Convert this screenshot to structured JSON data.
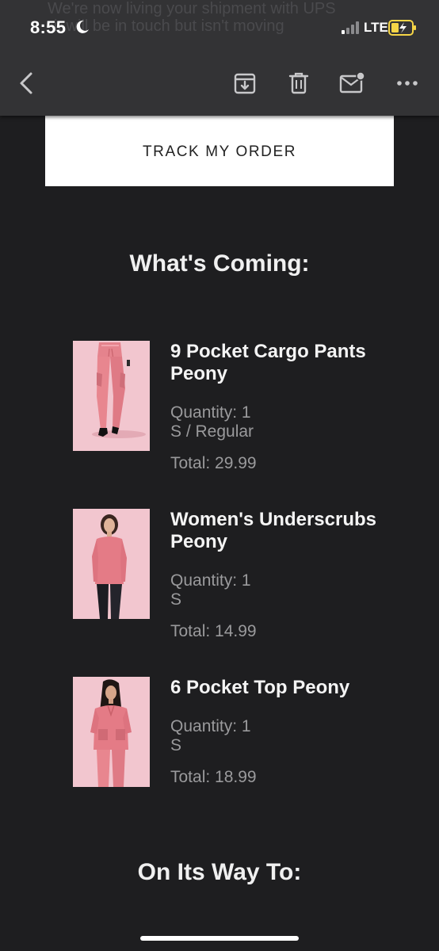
{
  "status_bar": {
    "time": "8:55",
    "network": "LTE"
  },
  "background_preview": {
    "line1": "We're now living your shipment with UPS",
    "line2": "it will be in touch but isn't moving"
  },
  "toolbar": {
    "icons": [
      "back-icon",
      "archive-icon",
      "trash-icon",
      "mark-unread-icon",
      "more-icon"
    ]
  },
  "track_button": {
    "label": "TRACK MY ORDER"
  },
  "whats_coming": {
    "title": "What's Coming:"
  },
  "items": [
    {
      "name": "9 Pocket Cargo Pants Peony",
      "quantity": "Quantity: 1",
      "variant": "S / Regular",
      "total": "Total: 29.99"
    },
    {
      "name": "Women's Underscrubs Peony",
      "quantity": "Quantity: 1",
      "variant": "S",
      "total": "Total: 14.99"
    },
    {
      "name": "6 Pocket Top Peony",
      "quantity": "Quantity: 1",
      "variant": "S",
      "total": "Total: 18.99"
    }
  ],
  "on_its_way": {
    "title": "On Its Way To:"
  },
  "colors": {
    "background": "#1e1e20",
    "toolbar": "#333335",
    "product_bg": "#f2c6cf",
    "peony": "#e8868f",
    "battery_fill": "#f5d547"
  }
}
